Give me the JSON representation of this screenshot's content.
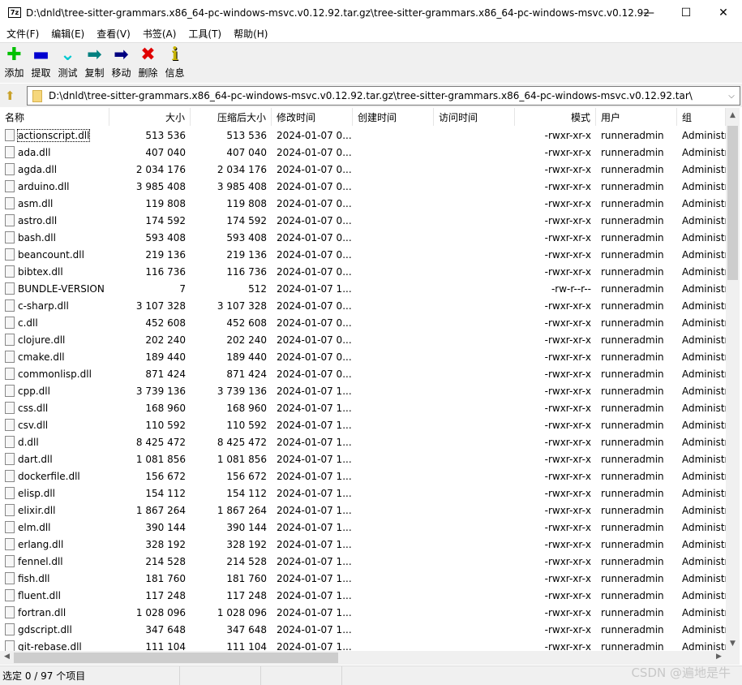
{
  "window": {
    "title": "D:\\dnld\\tree-sitter-grammars.x86_64-pc-windows-msvc.v0.12.92.tar.gz\\tree-sitter-grammars.x86_64-pc-windows-msvc.v0.12.92....",
    "app_icon": "7z",
    "minimize": "—",
    "maximize": "☐",
    "close": "✕"
  },
  "menu": [
    "文件(F)",
    "编辑(E)",
    "查看(V)",
    "书签(A)",
    "工具(T)",
    "帮助(H)"
  ],
  "toolbar": [
    {
      "label": "添加",
      "icon": "plus-icon",
      "glyph": "✚",
      "color": "#00c000"
    },
    {
      "label": "提取",
      "icon": "minus-icon",
      "glyph": "▬",
      "color": "#0000d0"
    },
    {
      "label": "测试",
      "icon": "check-chevron-icon",
      "glyph": "⌄",
      "color": "#00c8d0"
    },
    {
      "label": "复制",
      "icon": "copy-arrow-icon",
      "glyph": "➡",
      "color": "#008080"
    },
    {
      "label": "移动",
      "icon": "move-arrow-icon",
      "glyph": "➡",
      "color": "#000080"
    },
    {
      "label": "删除",
      "icon": "delete-x-icon",
      "glyph": "✖",
      "color": "#e00000"
    },
    {
      "label": "信息",
      "icon": "info-icon",
      "glyph": "i",
      "color": "#c8b400"
    }
  ],
  "address": {
    "path": "D:\\dnld\\tree-sitter-grammars.x86_64-pc-windows-msvc.v0.12.92.tar.gz\\tree-sitter-grammars.x86_64-pc-windows-msvc.v0.12.92.tar\\"
  },
  "columns": [
    "名称",
    "大小",
    "压缩后大小",
    "修改时间",
    "创建时间",
    "访问时间",
    "模式",
    "用户",
    "组"
  ],
  "rows": [
    [
      "actionscript.dll",
      "513 536",
      "513 536",
      "2024-01-07 0...",
      "-rwxr-xr-x",
      "runneradmin",
      "Administr"
    ],
    [
      "ada.dll",
      "407 040",
      "407 040",
      "2024-01-07 0...",
      "-rwxr-xr-x",
      "runneradmin",
      "Administr"
    ],
    [
      "agda.dll",
      "2 034 176",
      "2 034 176",
      "2024-01-07 0...",
      "-rwxr-xr-x",
      "runneradmin",
      "Administr"
    ],
    [
      "arduino.dll",
      "3 985 408",
      "3 985 408",
      "2024-01-07 0...",
      "-rwxr-xr-x",
      "runneradmin",
      "Administr"
    ],
    [
      "asm.dll",
      "119 808",
      "119 808",
      "2024-01-07 0...",
      "-rwxr-xr-x",
      "runneradmin",
      "Administr"
    ],
    [
      "astro.dll",
      "174 592",
      "174 592",
      "2024-01-07 0...",
      "-rwxr-xr-x",
      "runneradmin",
      "Administr"
    ],
    [
      "bash.dll",
      "593 408",
      "593 408",
      "2024-01-07 0...",
      "-rwxr-xr-x",
      "runneradmin",
      "Administr"
    ],
    [
      "beancount.dll",
      "219 136",
      "219 136",
      "2024-01-07 0...",
      "-rwxr-xr-x",
      "runneradmin",
      "Administr"
    ],
    [
      "bibtex.dll",
      "116 736",
      "116 736",
      "2024-01-07 0...",
      "-rwxr-xr-x",
      "runneradmin",
      "Administr"
    ],
    [
      "BUNDLE-VERSION",
      "7",
      "512",
      "2024-01-07 1...",
      "-rw-r--r--",
      "runneradmin",
      "Administr"
    ],
    [
      "c-sharp.dll",
      "3 107 328",
      "3 107 328",
      "2024-01-07 0...",
      "-rwxr-xr-x",
      "runneradmin",
      "Administr"
    ],
    [
      "c.dll",
      "452 608",
      "452 608",
      "2024-01-07 0...",
      "-rwxr-xr-x",
      "runneradmin",
      "Administr"
    ],
    [
      "clojure.dll",
      "202 240",
      "202 240",
      "2024-01-07 0...",
      "-rwxr-xr-x",
      "runneradmin",
      "Administr"
    ],
    [
      "cmake.dll",
      "189 440",
      "189 440",
      "2024-01-07 0...",
      "-rwxr-xr-x",
      "runneradmin",
      "Administr"
    ],
    [
      "commonlisp.dll",
      "871 424",
      "871 424",
      "2024-01-07 0...",
      "-rwxr-xr-x",
      "runneradmin",
      "Administr"
    ],
    [
      "cpp.dll",
      "3 739 136",
      "3 739 136",
      "2024-01-07 1...",
      "-rwxr-xr-x",
      "runneradmin",
      "Administr"
    ],
    [
      "css.dll",
      "168 960",
      "168 960",
      "2024-01-07 1...",
      "-rwxr-xr-x",
      "runneradmin",
      "Administr"
    ],
    [
      "csv.dll",
      "110 592",
      "110 592",
      "2024-01-07 1...",
      "-rwxr-xr-x",
      "runneradmin",
      "Administr"
    ],
    [
      "d.dll",
      "8 425 472",
      "8 425 472",
      "2024-01-07 1...",
      "-rwxr-xr-x",
      "runneradmin",
      "Administr"
    ],
    [
      "dart.dll",
      "1 081 856",
      "1 081 856",
      "2024-01-07 1...",
      "-rwxr-xr-x",
      "runneradmin",
      "Administr"
    ],
    [
      "dockerfile.dll",
      "156 672",
      "156 672",
      "2024-01-07 1...",
      "-rwxr-xr-x",
      "runneradmin",
      "Administr"
    ],
    [
      "elisp.dll",
      "154 112",
      "154 112",
      "2024-01-07 1...",
      "-rwxr-xr-x",
      "runneradmin",
      "Administr"
    ],
    [
      "elixir.dll",
      "1 867 264",
      "1 867 264",
      "2024-01-07 1...",
      "-rwxr-xr-x",
      "runneradmin",
      "Administr"
    ],
    [
      "elm.dll",
      "390 144",
      "390 144",
      "2024-01-07 1...",
      "-rwxr-xr-x",
      "runneradmin",
      "Administr"
    ],
    [
      "erlang.dll",
      "328 192",
      "328 192",
      "2024-01-07 1...",
      "-rwxr-xr-x",
      "runneradmin",
      "Administr"
    ],
    [
      "fennel.dll",
      "214 528",
      "214 528",
      "2024-01-07 1...",
      "-rwxr-xr-x",
      "runneradmin",
      "Administr"
    ],
    [
      "fish.dll",
      "181 760",
      "181 760",
      "2024-01-07 1...",
      "-rwxr-xr-x",
      "runneradmin",
      "Administr"
    ],
    [
      "fluent.dll",
      "117 248",
      "117 248",
      "2024-01-07 1...",
      "-rwxr-xr-x",
      "runneradmin",
      "Administr"
    ],
    [
      "fortran.dll",
      "1 028 096",
      "1 028 096",
      "2024-01-07 1...",
      "-rwxr-xr-x",
      "runneradmin",
      "Administr"
    ],
    [
      "gdscript.dll",
      "347 648",
      "347 648",
      "2024-01-07 1...",
      "-rwxr-xr-x",
      "runneradmin",
      "Administr"
    ],
    [
      "git-rebase.dll",
      "111 104",
      "111 104",
      "2024-01-07 1...",
      "-rwxr-xr-x",
      "runneradmin",
      "Administr"
    ]
  ],
  "status": {
    "selection": "选定 0 / 97 个项目"
  },
  "watermark": "CSDN @遍地是牛"
}
